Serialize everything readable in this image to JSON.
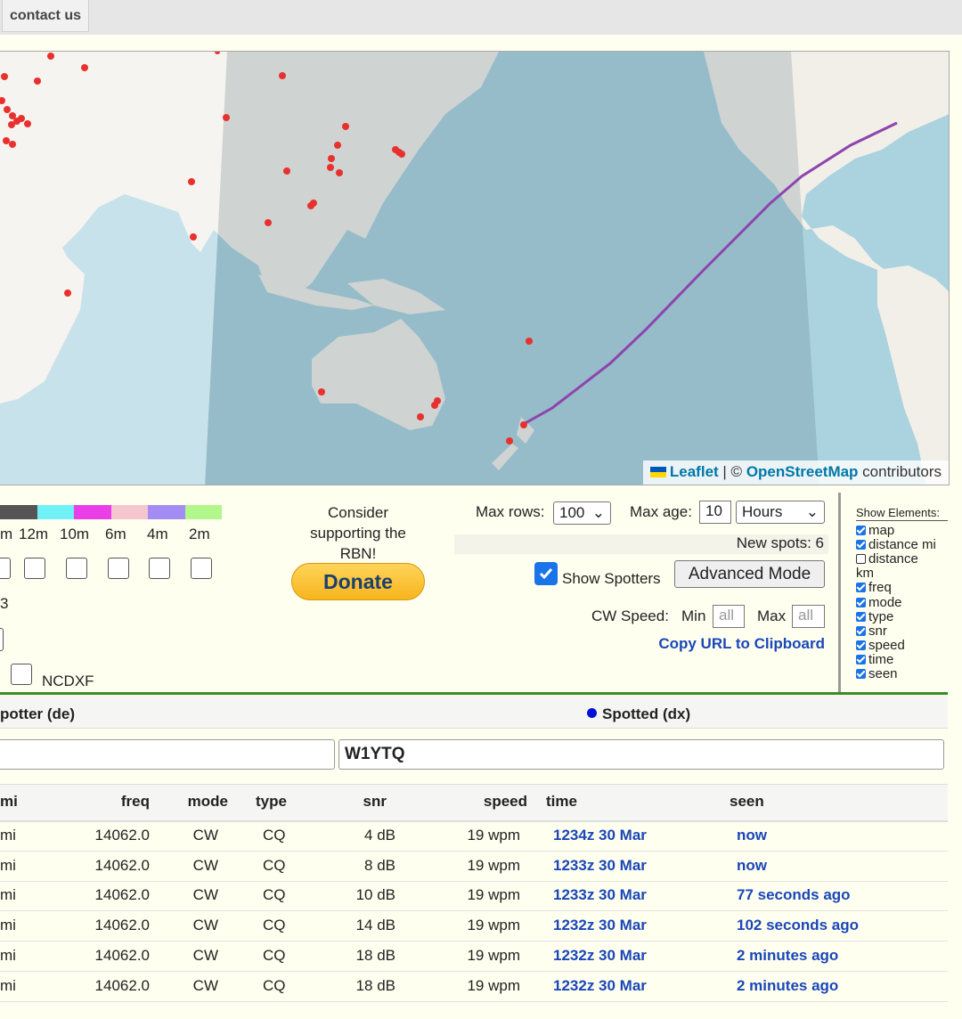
{
  "nav": {
    "contact_label": "contact us"
  },
  "map": {
    "attribution": {
      "leaflet": "Leaflet",
      "sep": " | © ",
      "osm": "OpenStreetMap",
      "suffix": " contributors"
    }
  },
  "bands": {
    "colors": [
      "#555555",
      "#6ff1f5",
      "#ea3ee8",
      "#f6c6cf",
      "#a38cf4",
      "#b1f78c"
    ],
    "labels": [
      "m",
      "12m",
      "10m",
      "6m",
      "4m",
      "2m"
    ],
    "fragment_3": "3",
    "ncdxf_label": "NCDXF"
  },
  "donation": {
    "message": "Consider supporting the RBN!",
    "button": "Donate"
  },
  "controls": {
    "max_rows_label": "Max rows:",
    "max_rows_value": "100",
    "max_age_label": "Max age:",
    "max_age_value": "10",
    "max_age_unit": "Hours",
    "new_spots": "New spots: 6",
    "show_spotters_label": "Show Spotters",
    "advanced_mode": "Advanced Mode",
    "cw_speed_label": "CW Speed:",
    "min_label": "Min",
    "min_placeholder": "all",
    "max_label": "Max",
    "max_placeholder": "all",
    "copy_url": "Copy URL to Clipboard"
  },
  "show_elements": {
    "title": "Show Elements:",
    "items": [
      {
        "label": "map",
        "checked": true
      },
      {
        "label": "distance mi",
        "checked": true
      },
      {
        "label": "distance",
        "checked": false
      },
      {
        "label": "km",
        "checked": null
      },
      {
        "label": "freq",
        "checked": true
      },
      {
        "label": "mode",
        "checked": true
      },
      {
        "label": "type",
        "checked": true
      },
      {
        "label": "snr",
        "checked": true
      },
      {
        "label": "speed",
        "checked": true
      },
      {
        "label": "time",
        "checked": true
      },
      {
        "label": "seen",
        "checked": true
      }
    ]
  },
  "table": {
    "spotter_header": "potter (de)",
    "spotted_header": "Spotted (dx)",
    "dx_filter_value": "W1YTQ",
    "columns": [
      "mi",
      "freq",
      "mode",
      "type",
      "snr",
      "speed",
      "time",
      "seen"
    ],
    "rows": [
      {
        "mi": "mi",
        "freq": "14062.0",
        "mode": "CW",
        "type": "CQ",
        "snr": "4 dB",
        "speed": "19 wpm",
        "time": "1234z 30 Mar",
        "seen": "now"
      },
      {
        "mi": "mi",
        "freq": "14062.0",
        "mode": "CW",
        "type": "CQ",
        "snr": "8 dB",
        "speed": "19 wpm",
        "time": "1233z 30 Mar",
        "seen": "now"
      },
      {
        "mi": "mi",
        "freq": "14062.0",
        "mode": "CW",
        "type": "CQ",
        "snr": "10 dB",
        "speed": "19 wpm",
        "time": "1233z 30 Mar",
        "seen": "77 seconds ago"
      },
      {
        "mi": "mi",
        "freq": "14062.0",
        "mode": "CW",
        "type": "CQ",
        "snr": "14 dB",
        "speed": "19 wpm",
        "time": "1232z 30 Mar",
        "seen": "102 seconds ago"
      },
      {
        "mi": "mi",
        "freq": "14062.0",
        "mode": "CW",
        "type": "CQ",
        "snr": "18 dB",
        "speed": "19 wpm",
        "time": "1232z 30 Mar",
        "seen": "2 minutes ago"
      },
      {
        "mi": "mi",
        "freq": "14062.0",
        "mode": "CW",
        "type": "CQ",
        "snr": "18 dB",
        "speed": "19 wpm",
        "time": "1232z 30 Mar",
        "seen": "2 minutes ago"
      }
    ]
  }
}
